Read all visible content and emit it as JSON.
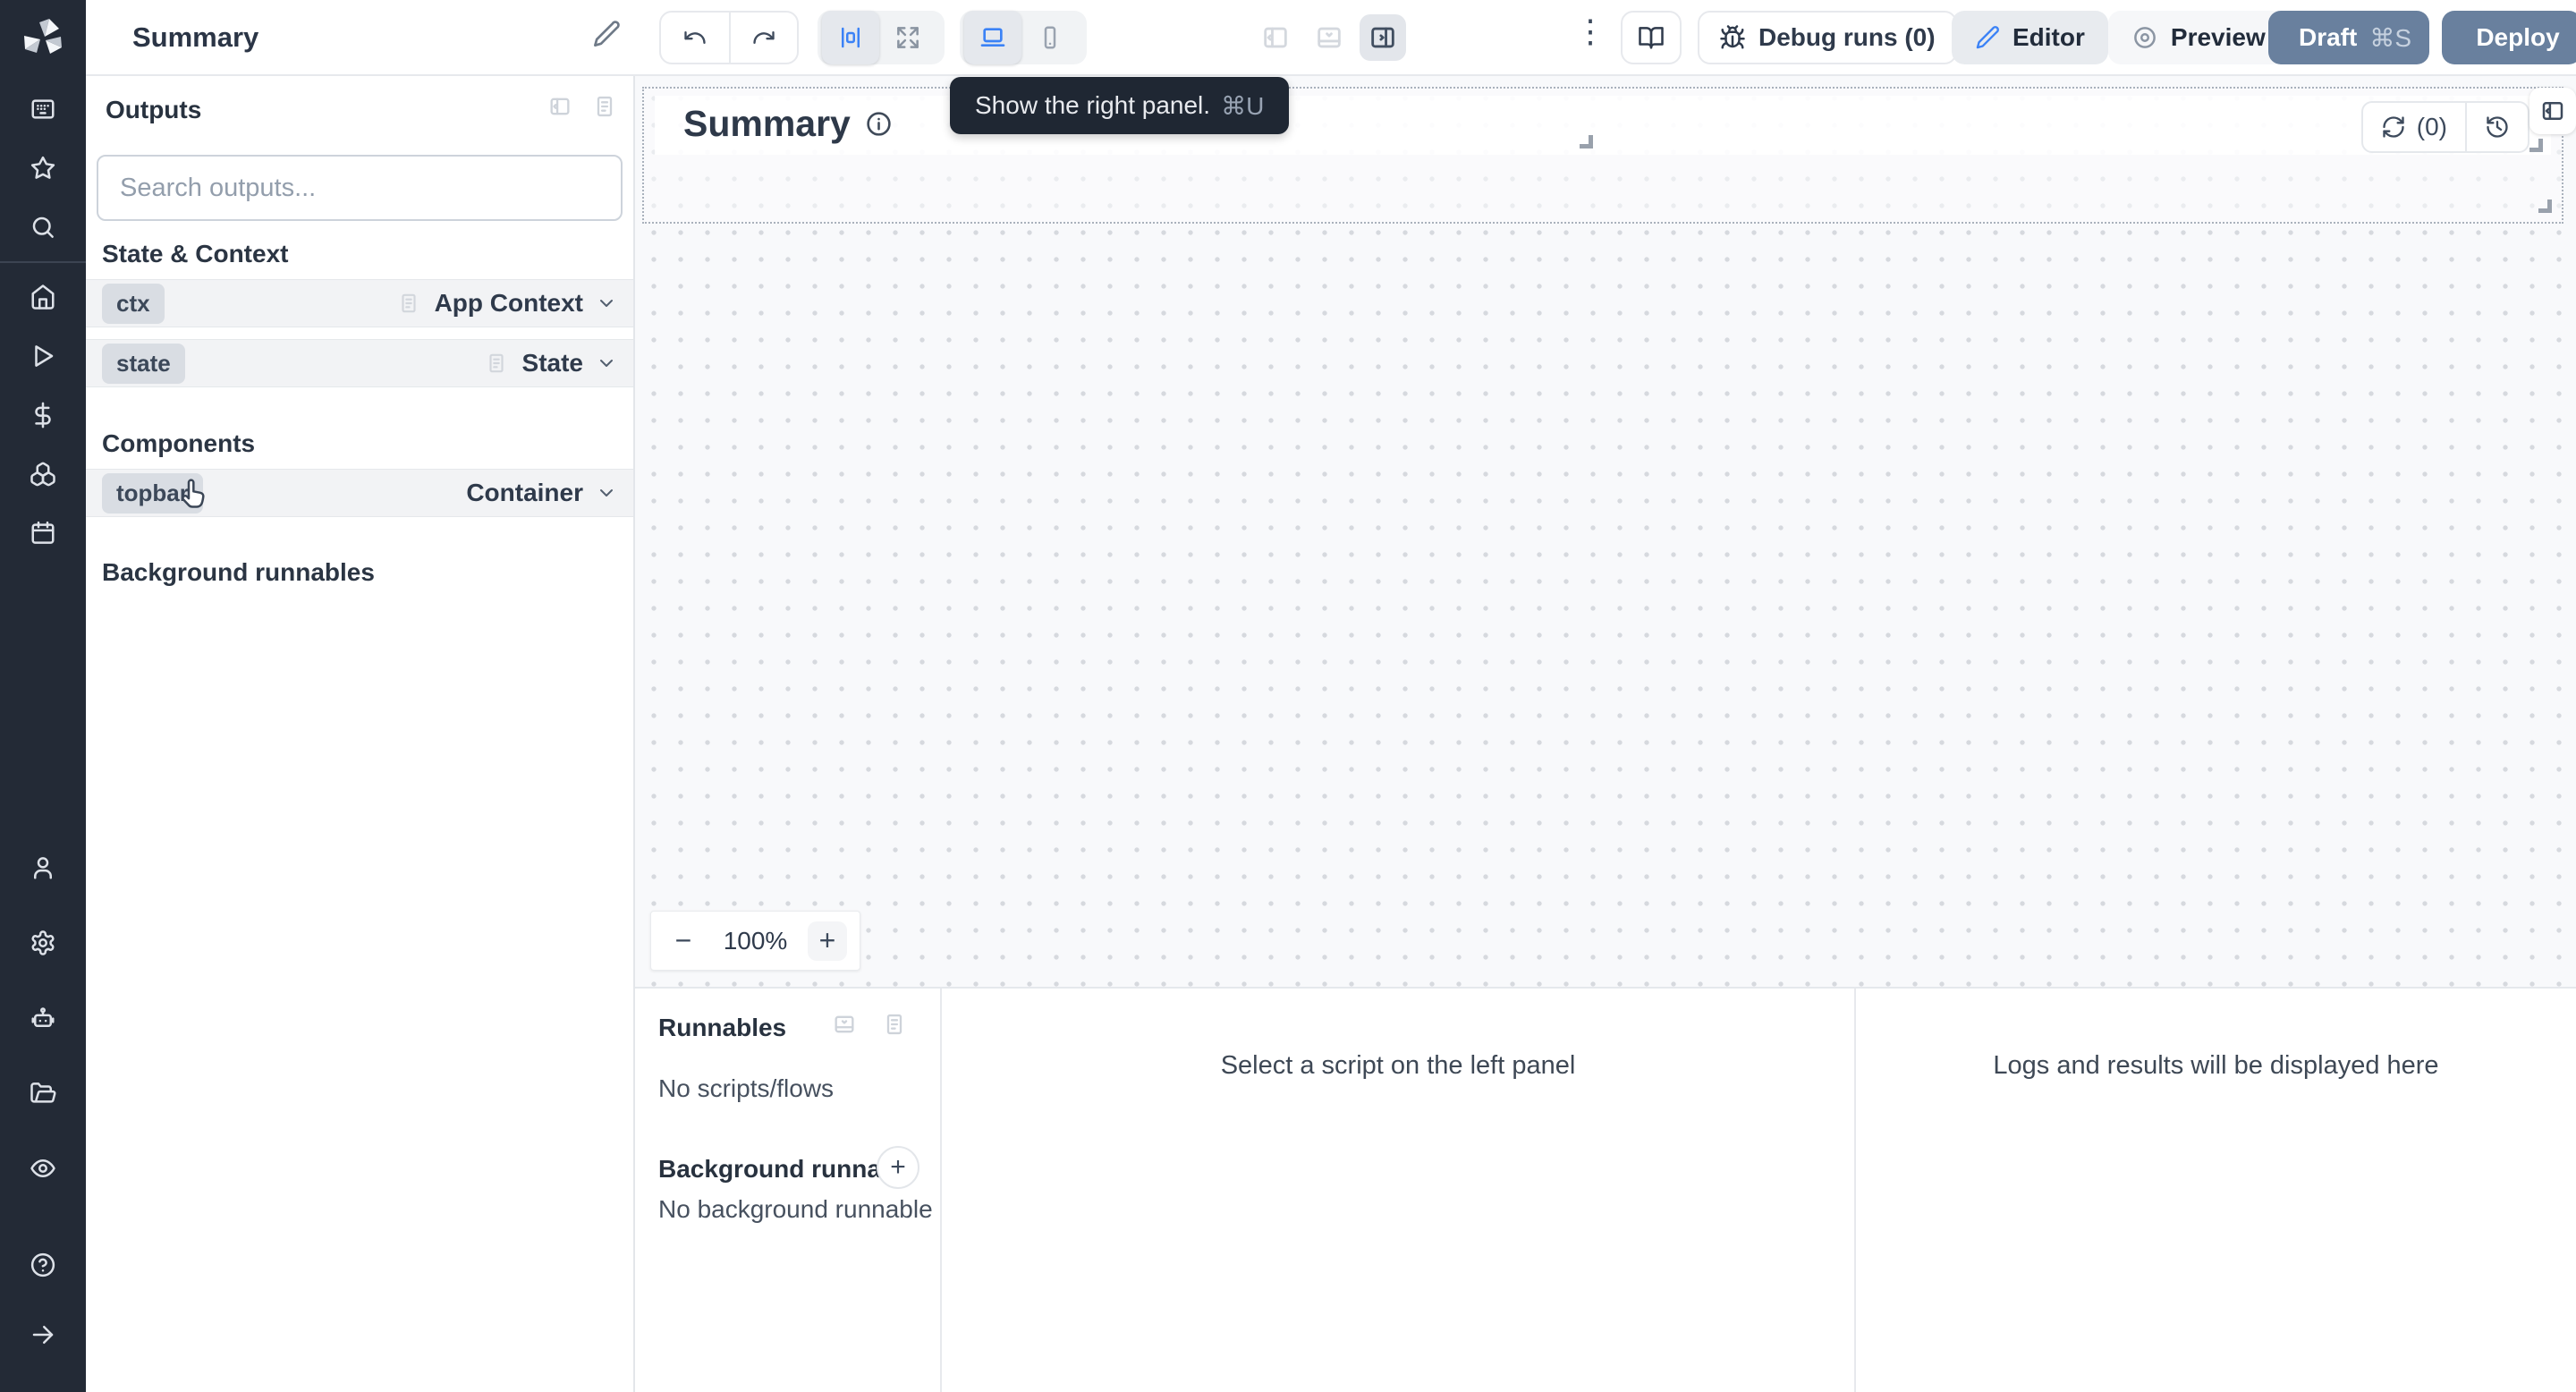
{
  "topbar": {
    "title": "Summary",
    "kebab": "⋮",
    "debug_runs": "Debug runs (0)",
    "editor": "Editor",
    "preview": "Preview",
    "draft": "Draft",
    "draft_shortcut": "⌘S",
    "deploy": "Deploy"
  },
  "tooltip": {
    "text": "Show the right panel.",
    "shortcut": "⌘U"
  },
  "outputs": {
    "header": "Outputs",
    "search_placeholder": "Search outputs...",
    "sections": {
      "state_context": "State & Context",
      "components": "Components",
      "background": "Background runnables"
    },
    "rows": [
      {
        "badge": "ctx",
        "type": "App Context"
      },
      {
        "badge": "state",
        "type": "State"
      },
      {
        "badge": "topbar",
        "type": "Container"
      }
    ]
  },
  "canvas": {
    "title": "Summary",
    "refresh_count": "(0)",
    "zoom": {
      "minus": "−",
      "level": "100%",
      "plus": "+"
    }
  },
  "runnables": {
    "header": "Runnables",
    "empty": "No scripts/flows",
    "background_header": "Background runna...",
    "background_add": "+",
    "background_empty": "No background runnable"
  },
  "panels": {
    "script": "Select a script on the left panel",
    "logs": "Logs and results will be displayed here"
  },
  "colors": {
    "accent_blue": "#3b82f6",
    "slate_button": "#69809e",
    "rail_bg": "#232a36",
    "tooltip_bg": "#1f2733",
    "canvas_bg": "#f8f9fb"
  },
  "icons": {
    "kebab-menu-icon": "⋮",
    "minus-icon": "−",
    "plus-icon": "+"
  }
}
